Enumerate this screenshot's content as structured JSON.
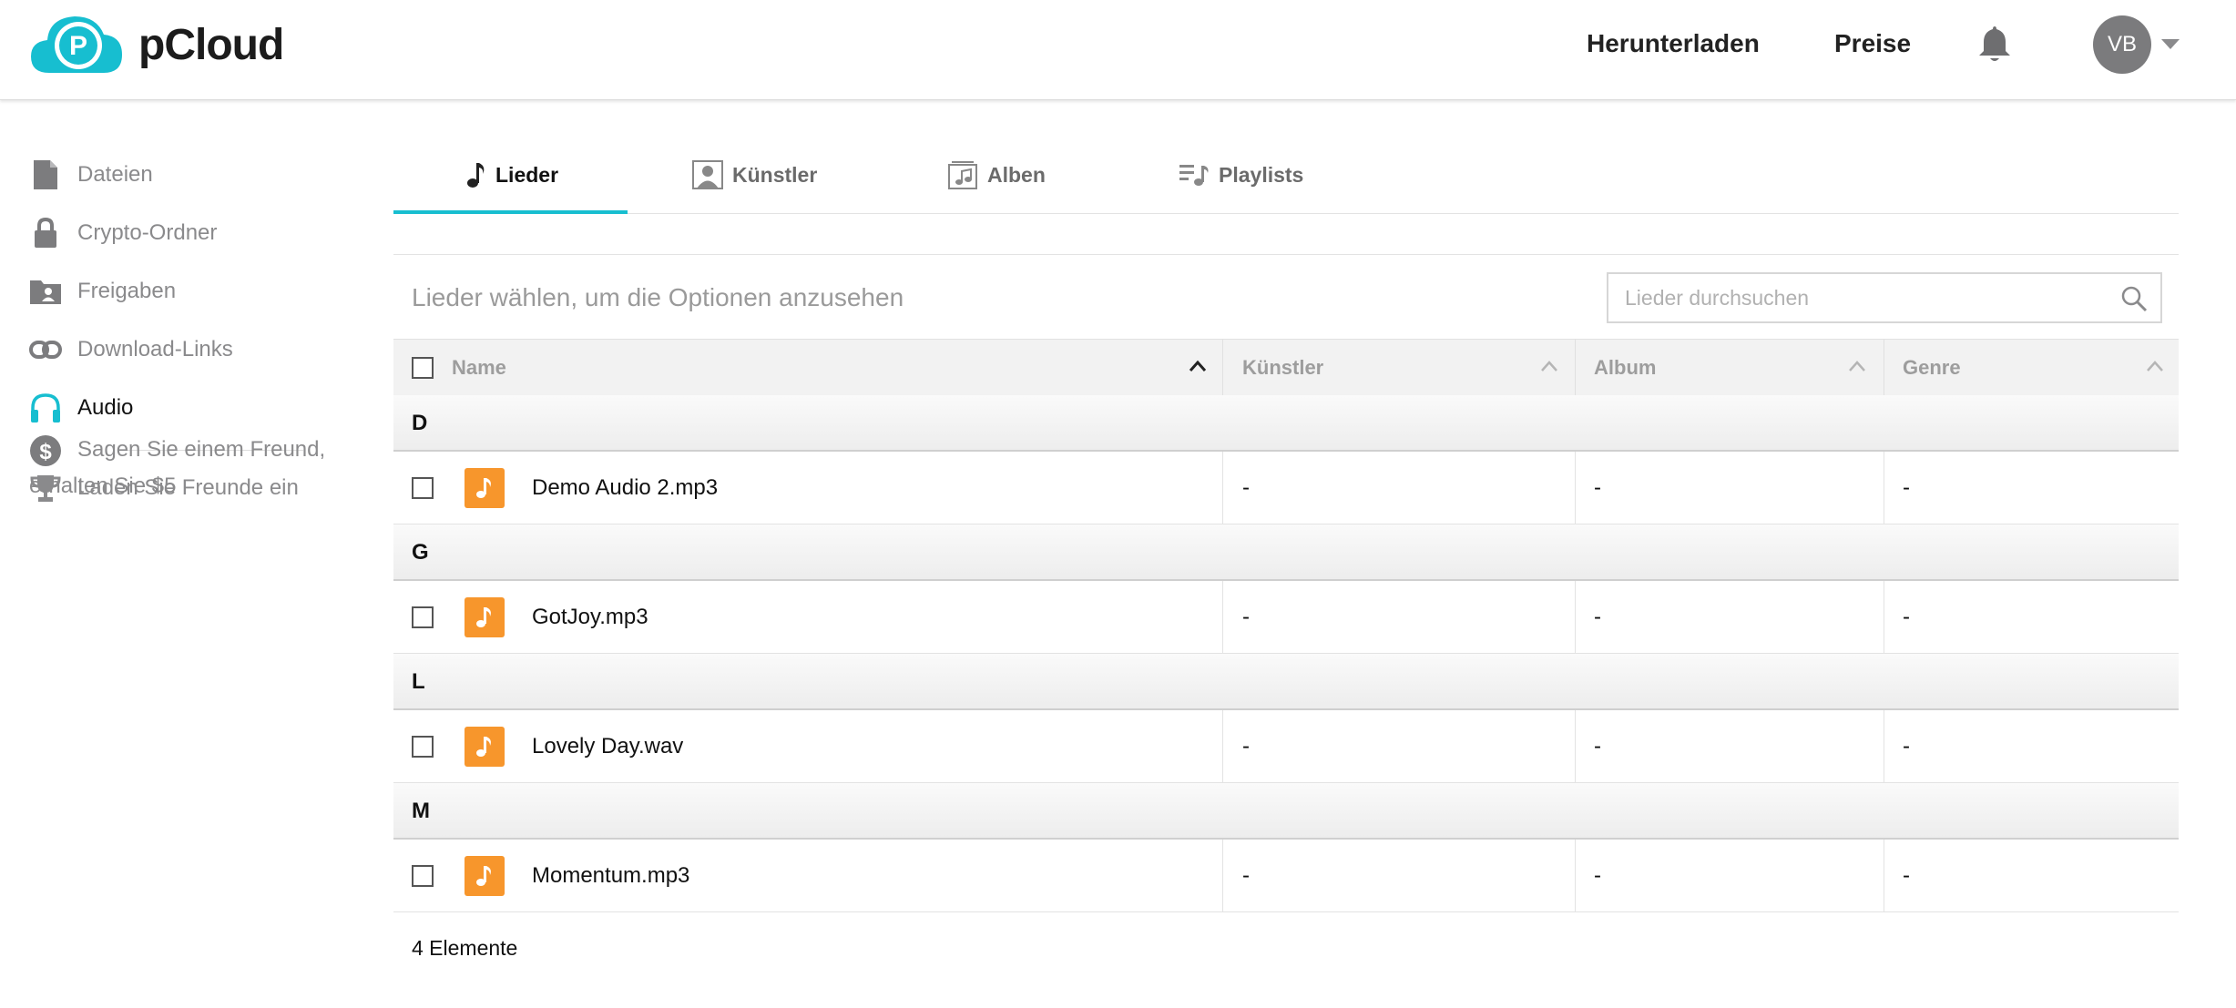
{
  "header": {
    "brand": "pCloud",
    "nav": [
      "Herunterladen",
      "Preise"
    ],
    "avatar_initials": "VB",
    "accent_color": "#17bed0"
  },
  "sidebar": {
    "items": [
      {
        "label": "Dateien",
        "icon": "file-icon"
      },
      {
        "label": "Crypto-Ordner",
        "icon": "lock-icon"
      },
      {
        "label": "Freigaben",
        "icon": "shared-folder-icon"
      },
      {
        "label": "Download-Links",
        "icon": "link-icon"
      },
      {
        "label": "Audio",
        "icon": "headphones-icon",
        "active": true
      }
    ],
    "extras": [
      {
        "label": "Laden Sie Freunde ein",
        "icon": "trophy-icon"
      },
      {
        "label": "Sagen Sie einem Freund, erhalten Sie $5",
        "icon": "dollar-icon"
      }
    ]
  },
  "tabs": [
    {
      "label": "Lieder",
      "icon": "music-note-icon",
      "active": true
    },
    {
      "label": "Künstler",
      "icon": "artist-icon"
    },
    {
      "label": "Alben",
      "icon": "album-icon"
    },
    {
      "label": "Playlists",
      "icon": "playlist-icon"
    }
  ],
  "toolbar": {
    "hint": "Lieder wählen, um die Optionen anzusehen",
    "search_placeholder": "Lieder durchsuchen"
  },
  "table": {
    "columns": [
      "Name",
      "Künstler",
      "Album",
      "Genre"
    ],
    "groups": [
      {
        "letter": "D",
        "rows": [
          {
            "name": "Demo Audio 2.mp3",
            "artist": "-",
            "album": "-",
            "genre": "-"
          }
        ]
      },
      {
        "letter": "G",
        "rows": [
          {
            "name": "GotJoy.mp3",
            "artist": "-",
            "album": "-",
            "genre": "-"
          }
        ]
      },
      {
        "letter": "L",
        "rows": [
          {
            "name": "Lovely Day.wav",
            "artist": "-",
            "album": "-",
            "genre": "-"
          }
        ]
      },
      {
        "letter": "M",
        "rows": [
          {
            "name": "Momentum.mp3",
            "artist": "-",
            "album": "-",
            "genre": "-"
          }
        ]
      }
    ],
    "file_icon_color": "#f7962c"
  },
  "footer": {
    "count": "4 Elemente"
  }
}
